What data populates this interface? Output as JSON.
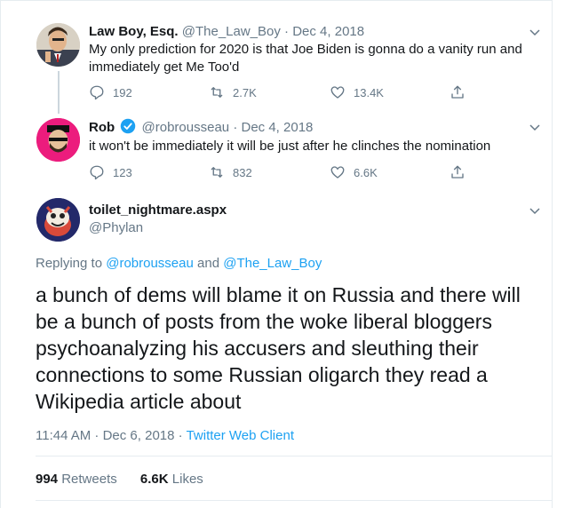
{
  "tweets": [
    {
      "name": "Law Boy, Esq.",
      "handle": "@The_Law_Boy",
      "separator": "·",
      "date": "Dec 4, 2018",
      "text": "My only prediction for 2020 is that Joe Biden is gonna do a vanity run and immediately get Me Too'd",
      "replies": "192",
      "retweets": "2.7K",
      "likes": "13.4K"
    },
    {
      "name": "Rob",
      "handle": "@robrousseau",
      "separator": "·",
      "date": "Dec 4, 2018",
      "text": "it won't be immediately it will be just after he clinches the nomination",
      "replies": "123",
      "retweets": "832",
      "likes": "6.6K"
    }
  ],
  "main": {
    "name": "toilet_nightmare.aspx",
    "handle": "@Phylan",
    "replying_prefix": "Replying to",
    "replying_user1": "@robrousseau",
    "replying_and": "and",
    "replying_user2": "@The_Law_Boy",
    "text": "a bunch of dems will blame it on Russia and there will be a bunch of posts from the woke liberal bloggers psychoanalyzing his accusers and sleuthing their connections to some Russian oligarch they read a Wikipedia article about",
    "timestamp": "11:44 AM · Dec 6, 2018 ·",
    "client": "Twitter Web Client",
    "retweets_count": "994",
    "retweets_label": "Retweets",
    "likes_count": "6.6K",
    "likes_label": "Likes"
  },
  "colors": {
    "accent": "#1da1f2",
    "muted": "#657786",
    "verified": "#1da1f2",
    "border": "#e6ecf0"
  }
}
